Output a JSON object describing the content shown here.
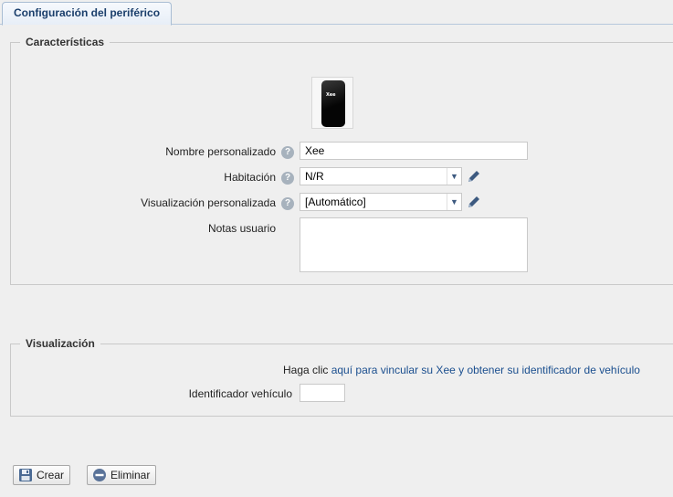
{
  "tab": {
    "label": "Configuración del periférico"
  },
  "caracteristicas": {
    "legend": "Características",
    "device_logo": "Xee",
    "rows": {
      "nombre": {
        "label": "Nombre personalizado",
        "value": "Xee"
      },
      "habitacion": {
        "label": "Habitación",
        "value": "N/R"
      },
      "visualizacion": {
        "label": "Visualización personalizada",
        "value": "[Automático]"
      },
      "notas": {
        "label": "Notas usuario",
        "value": ""
      }
    },
    "help_glyph": "?"
  },
  "visualizacion": {
    "legend": "Visualización",
    "link_prefix": "Haga clic",
    "link_text": "aquí para vincular su Xee y obtener su identificador de vehículo",
    "identificador": {
      "label": "Identificador vehículo",
      "value": ""
    }
  },
  "buttons": {
    "crear": "Crear",
    "eliminar": "Eliminar"
  },
  "colors": {
    "tab_text": "#1a3e6b",
    "link": "#1b4f8f",
    "help_icon": "#a7b2bd",
    "pencil": "#3d5a80"
  },
  "icons": [
    "help-icon",
    "chevron-down-icon",
    "pencil-icon",
    "floppy-disk-icon",
    "minus-circle-icon"
  ]
}
